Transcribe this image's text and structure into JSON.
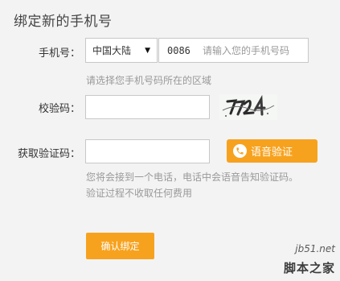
{
  "title": "绑定新的手机号",
  "phone": {
    "label": "手机号：",
    "country": "中国大陆",
    "prefix": "0086",
    "placeholder": "请输入您的手机号码",
    "hint": "请选择您手机号码所在的区域"
  },
  "captcha": {
    "label": "校验码：",
    "image_text": "7724"
  },
  "verify": {
    "label": "获取验证码：",
    "voice_button": "语音验证",
    "hint_line1": "您将会接到一个电话，电话中会语音告知验证码。",
    "hint_line2": "验证过程不收取任何费用"
  },
  "confirm_button": "确认绑定",
  "watermark": {
    "domain": "jb51.net",
    "name": "脚本之家"
  },
  "colors": {
    "accent": "#f7a21e",
    "background": "#f3f3f3",
    "hint_text": "#999999"
  }
}
